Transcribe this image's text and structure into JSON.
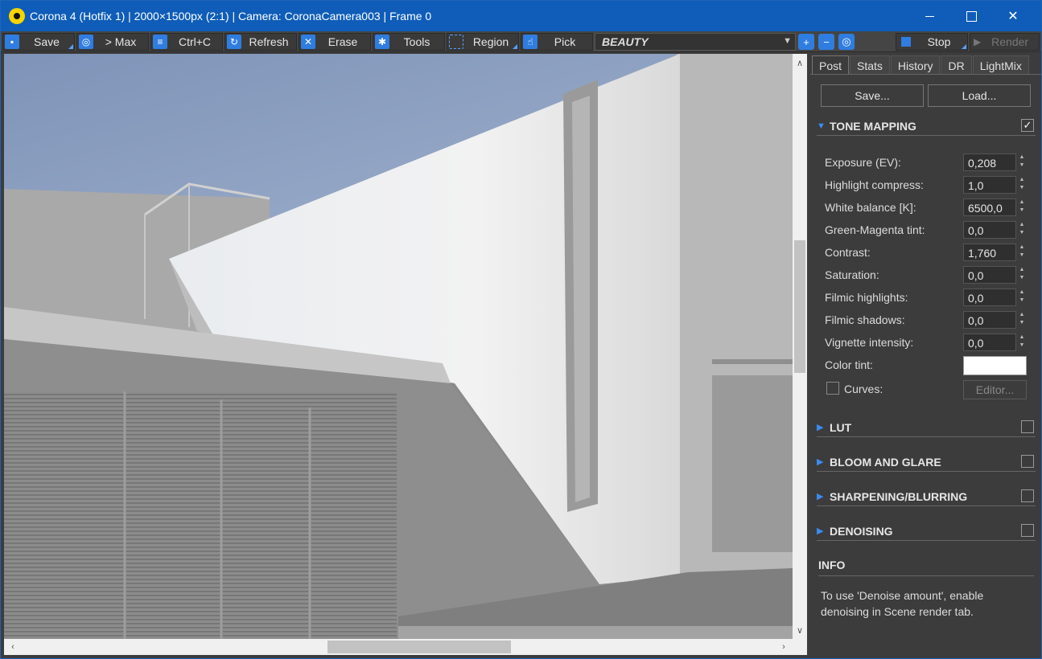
{
  "window": {
    "title": "Corona 4 (Hotfix 1) | 2000×1500px (2:1) | Camera: CoronaCamera003 | Frame 0"
  },
  "toolbar": {
    "save": "Save",
    "max": "> Max",
    "copy": "Ctrl+C",
    "refresh": "Refresh",
    "erase": "Erase",
    "tools": "Tools",
    "region": "Region",
    "pick": "Pick",
    "channel": "BEAUTY",
    "stop": "Stop",
    "render": "Render"
  },
  "panel": {
    "tabs": [
      "Post",
      "Stats",
      "History",
      "DR",
      "LightMix"
    ],
    "save_btn": "Save...",
    "load_btn": "Load...",
    "tone_mapping": {
      "title": "TONE MAPPING",
      "enabled": true,
      "params": [
        {
          "label": "Exposure (EV):",
          "value": "0,208"
        },
        {
          "label": "Highlight compress:",
          "value": "1,0"
        },
        {
          "label": "White balance [K]:",
          "value": "6500,0"
        },
        {
          "label": "Green-Magenta tint:",
          "value": "0,0"
        },
        {
          "label": "Contrast:",
          "value": "1,760"
        },
        {
          "label": "Saturation:",
          "value": "0,0"
        },
        {
          "label": "Filmic highlights:",
          "value": "0,0"
        },
        {
          "label": "Filmic shadows:",
          "value": "0,0"
        },
        {
          "label": "Vignette intensity:",
          "value": "0,0"
        }
      ],
      "color_tint_label": "Color tint:",
      "color_tint": "#ffffff",
      "curves_label": "Curves:",
      "editor_btn": "Editor..."
    },
    "sections": [
      "LUT",
      "BLOOM AND GLARE",
      "SHARPENING/BLURRING",
      "DENOISING"
    ],
    "info_title": "INFO",
    "info_text": "To use 'Denoise amount', enable denoising in Scene render tab."
  }
}
